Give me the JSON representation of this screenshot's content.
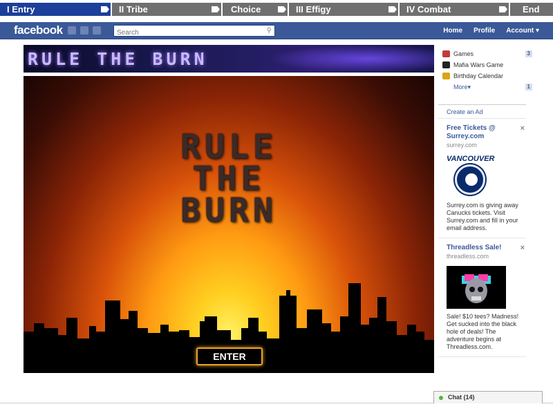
{
  "steps": [
    {
      "label": "I   Entry"
    },
    {
      "label": "II  Tribe"
    },
    {
      "label": "Choice"
    },
    {
      "label": "III  Effigy"
    },
    {
      "label": "IV  Combat"
    },
    {
      "label": "End"
    }
  ],
  "header": {
    "logo": "facebook",
    "search_placeholder": "Search",
    "nav": {
      "home": "Home",
      "profile": "Profile",
      "account": "Account ▾"
    }
  },
  "banner": {
    "title": "RULE THE BURN"
  },
  "game": {
    "title_lines": [
      "RULE",
      "THE",
      "BURN"
    ],
    "enter_label": "ENTER"
  },
  "sidebar": {
    "apps": [
      {
        "label": "Games",
        "count": "3",
        "icon": "games-icon",
        "color": "#c23a3a"
      },
      {
        "label": "Mafia Wars Game",
        "count": "",
        "icon": "mafia-wars-icon",
        "color": "#222222"
      },
      {
        "label": "Birthday Calendar",
        "count": "",
        "icon": "calendar-icon",
        "color": "#d9a51a"
      }
    ],
    "more_label": "More▾",
    "more_count": "1"
  },
  "ads": {
    "create_label": "Create an Ad",
    "items": [
      {
        "title": "Free Tickets @ Surrey.com",
        "domain": "surrey.com",
        "logo_word": "VANCOUVER",
        "body": "Surrey.com is giving away Canucks tickets. Visit Surrey.com and fill in your email address."
      },
      {
        "title": "Threadless Sale!",
        "domain": "threadless.com",
        "body": "Sale! $10 tees? Madness! Get sucked into the black hole of deals! The adventure begins at Threadless.com."
      }
    ]
  },
  "chat": {
    "label": "Chat (14)"
  }
}
